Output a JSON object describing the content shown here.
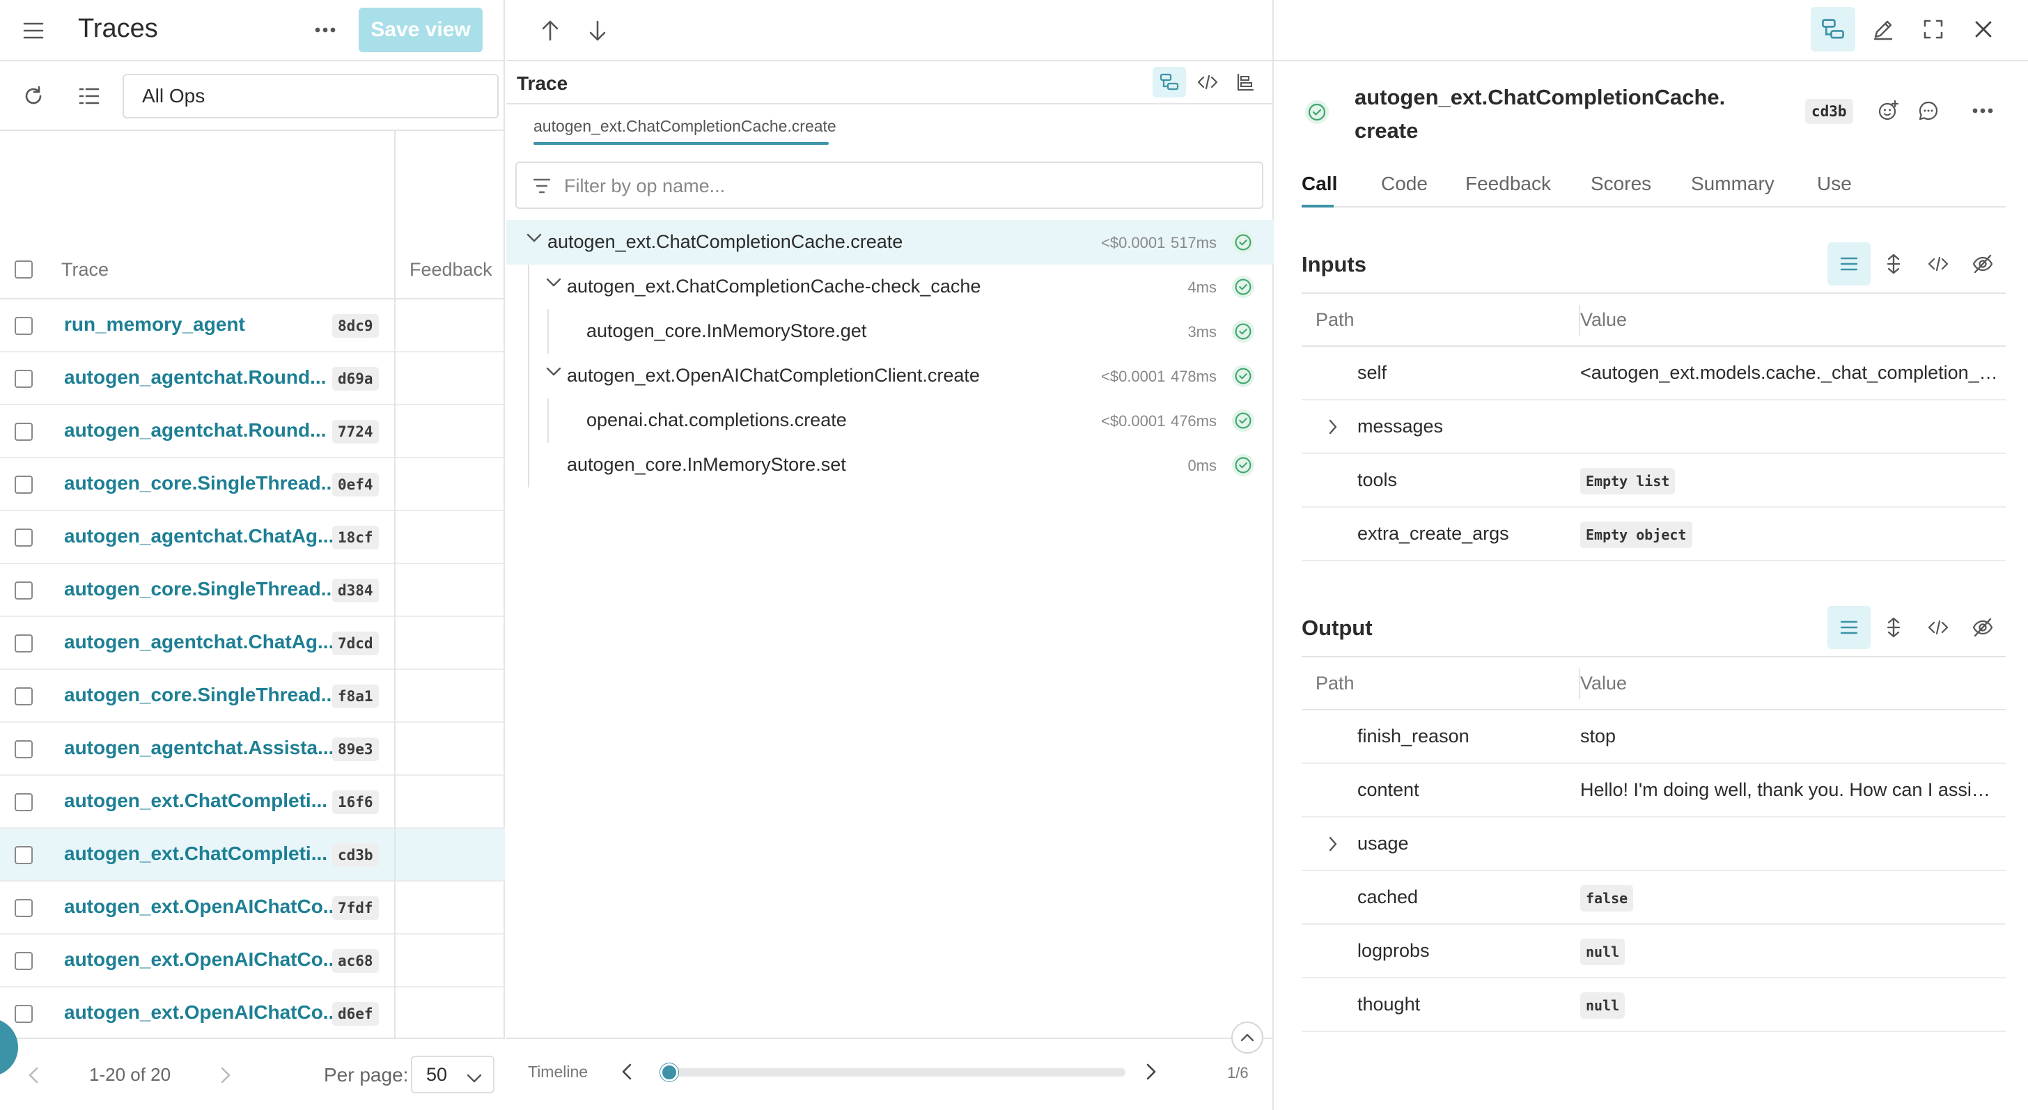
{
  "header": {
    "title": "Traces",
    "save_view_label": "Save view"
  },
  "toolbar": {
    "ops_filter_value": "All Ops"
  },
  "table": {
    "columns": [
      "Trace",
      "Feedback"
    ],
    "rows": [
      {
        "name": "run_memory_agent",
        "id": "8dc9"
      },
      {
        "name": "autogen_agentchat.Round...",
        "id": "d69a"
      },
      {
        "name": "autogen_agentchat.Round...",
        "id": "7724"
      },
      {
        "name": "autogen_core.SingleThread...",
        "id": "0ef4"
      },
      {
        "name": "autogen_agentchat.ChatAg...",
        "id": "18cf"
      },
      {
        "name": "autogen_core.SingleThread...",
        "id": "d384"
      },
      {
        "name": "autogen_agentchat.ChatAg...",
        "id": "7dcd"
      },
      {
        "name": "autogen_core.SingleThread...",
        "id": "f8a1"
      },
      {
        "name": "autogen_agentchat.Assista...",
        "id": "89e3"
      },
      {
        "name": "autogen_ext.ChatCompleti...",
        "id": "16f6"
      },
      {
        "name": "autogen_ext.ChatCompleti...",
        "id": "cd3b",
        "selected": true
      },
      {
        "name": "autogen_ext.OpenAIChatCo...",
        "id": "7fdf"
      },
      {
        "name": "autogen_ext.OpenAIChatCo...",
        "id": "ac68"
      },
      {
        "name": "autogen_ext.OpenAIChatCo...",
        "id": "d6ef"
      }
    ]
  },
  "pagination": {
    "range_text": "1-20 of 20",
    "per_page_label": "Per page:",
    "per_page_value": "50"
  },
  "trace": {
    "title": "Trace",
    "breadcrumb": "autogen_ext.ChatCompletionCache.create",
    "filter_placeholder": "Filter by op name...",
    "nodes": [
      {
        "name": "autogen_ext.ChatCompletionCache.create",
        "cost": "<$0.0001",
        "duration": "517ms",
        "expanded": true,
        "selected": true
      },
      {
        "name": "autogen_ext.ChatCompletionCache-check_cache",
        "cost": "",
        "duration": "4ms",
        "expanded": true
      },
      {
        "name": "autogen_core.InMemoryStore.get",
        "cost": "",
        "duration": "3ms"
      },
      {
        "name": "autogen_ext.OpenAIChatCompletionClient.create",
        "cost": "<$0.0001",
        "duration": "478ms",
        "expanded": true
      },
      {
        "name": "openai.chat.completions.create",
        "cost": "<$0.0001",
        "duration": "476ms"
      },
      {
        "name": "autogen_core.InMemoryStore.set",
        "cost": "",
        "duration": "0ms"
      }
    ],
    "timeline_label": "Timeline",
    "timeline_count": "1/6"
  },
  "call": {
    "name": "autogen_ext.ChatCompletionCache.create",
    "id": "cd3b",
    "tabs": [
      "Call",
      "Code",
      "Feedback",
      "Scores",
      "Summary",
      "Use"
    ],
    "active_tab": "Call"
  },
  "inputs": {
    "title": "Inputs",
    "path_header": "Path",
    "value_header": "Value",
    "rows": [
      {
        "key": "self",
        "value": "<autogen_ext.models.cache._chat_completion_cache.ChatCompletionCache object>",
        "type": "text"
      },
      {
        "key": "messages",
        "value": "",
        "type": "expand"
      },
      {
        "key": "tools",
        "value": "Empty list",
        "type": "chip"
      },
      {
        "key": "extra_create_args",
        "value": "Empty object",
        "type": "chip"
      }
    ]
  },
  "output": {
    "title": "Output",
    "path_header": "Path",
    "value_header": "Value",
    "rows": [
      {
        "key": "finish_reason",
        "value": "stop",
        "type": "text"
      },
      {
        "key": "content",
        "value": "Hello! I'm doing well, thank you. How can I assist you today?",
        "type": "text"
      },
      {
        "key": "usage",
        "value": "",
        "type": "expand"
      },
      {
        "key": "cached",
        "value": "false",
        "type": "chip"
      },
      {
        "key": "logprobs",
        "value": "null",
        "type": "chip"
      },
      {
        "key": "thought",
        "value": "null",
        "type": "chip"
      }
    ]
  },
  "colors": {
    "accent": "#3c93a7",
    "link": "#1d7f94",
    "selected_bg": "#e8f6f9",
    "success": "#3ea66e"
  }
}
